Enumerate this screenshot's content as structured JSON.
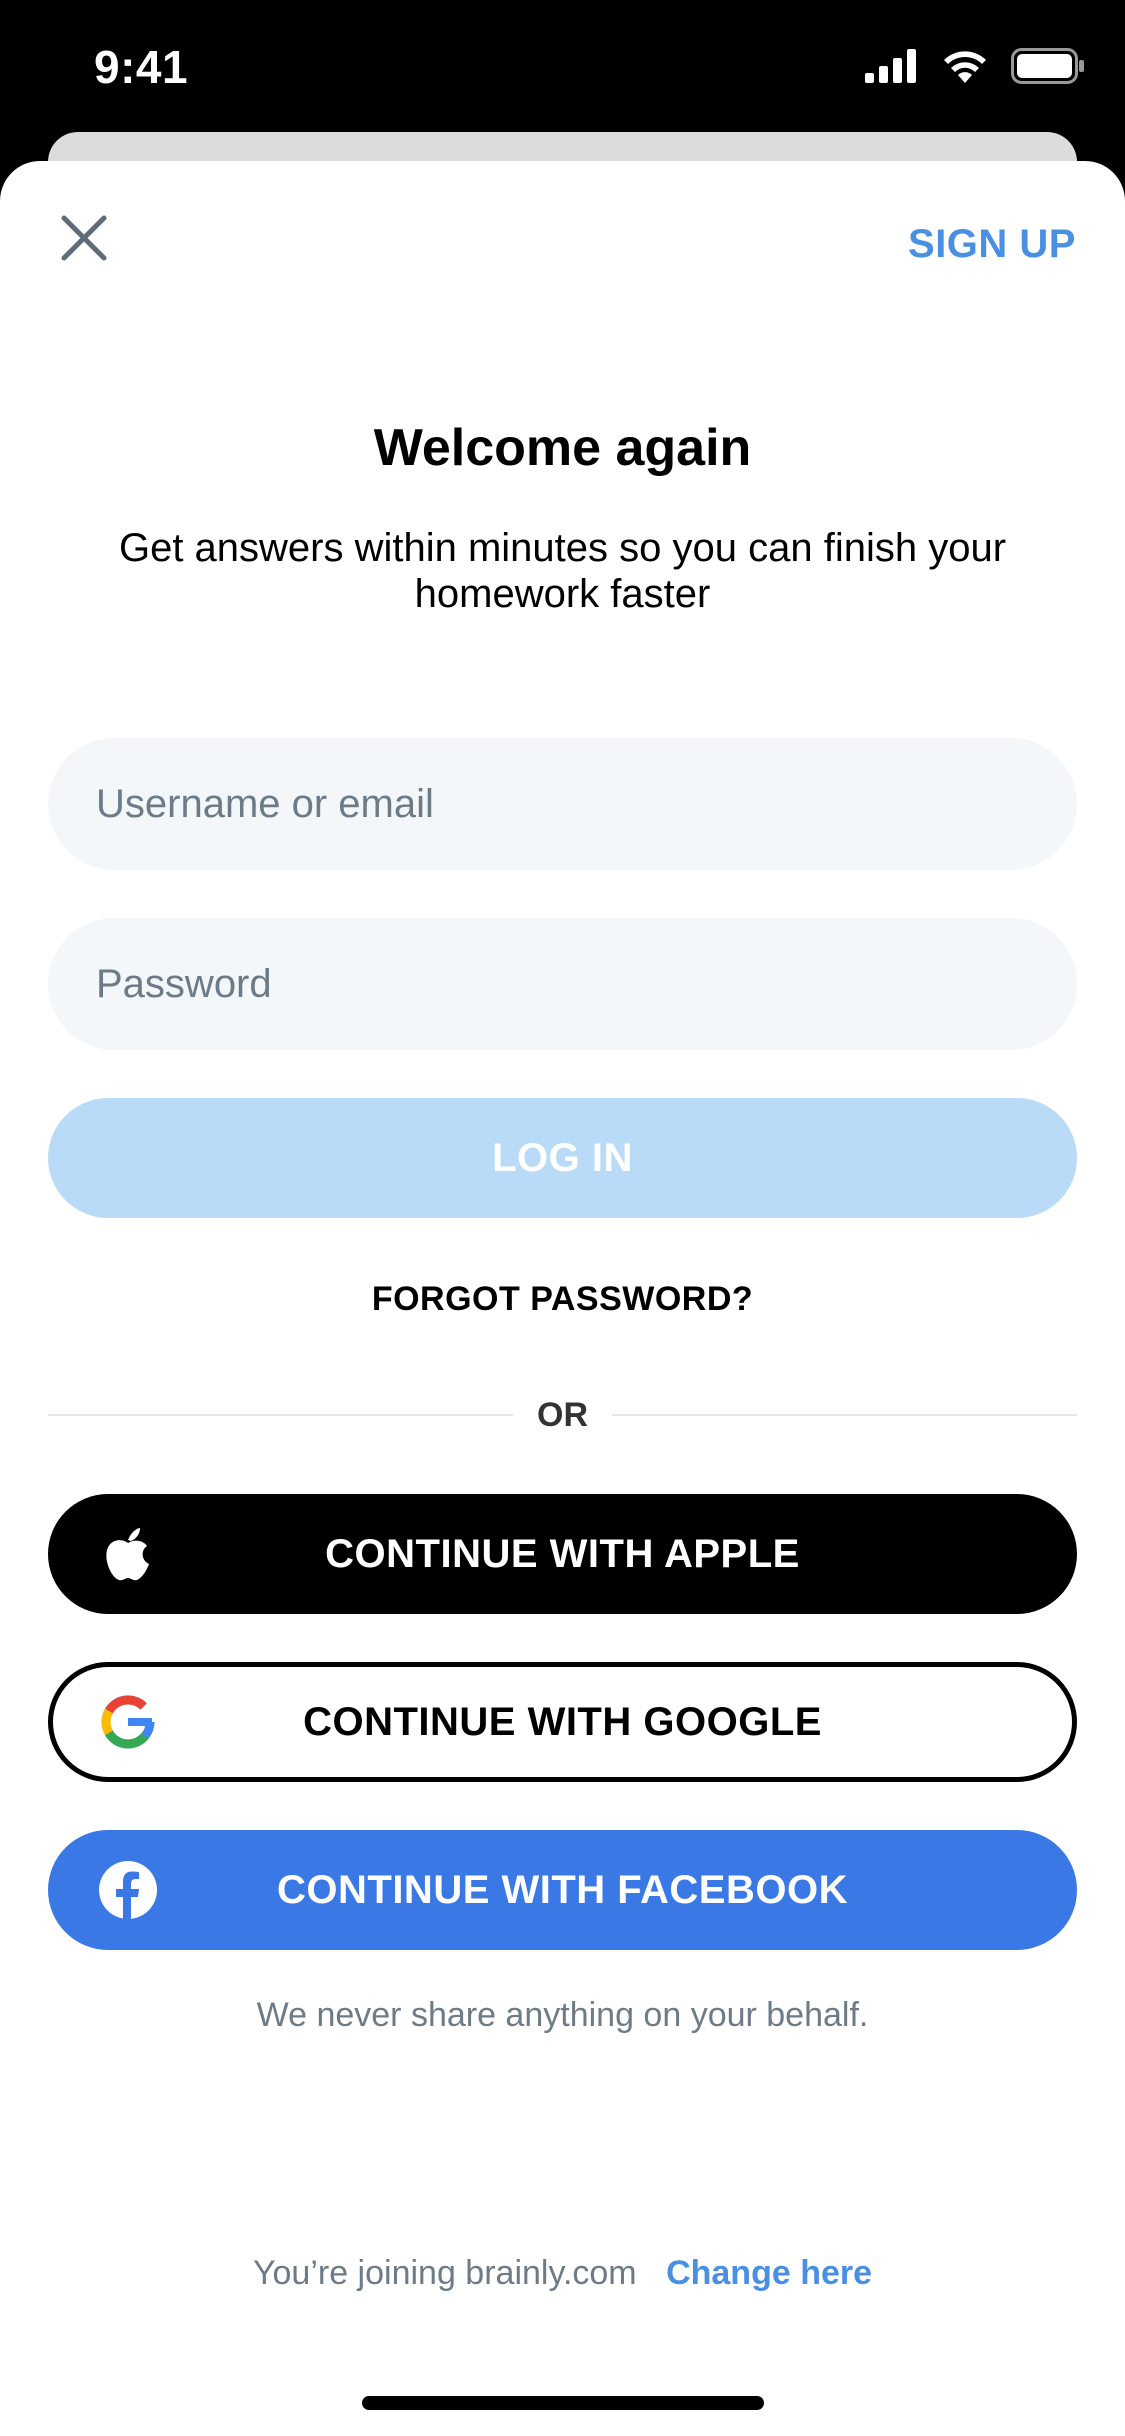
{
  "status_bar": {
    "time": "9:41",
    "icons": [
      "cellular-signal-icon",
      "wifi-icon",
      "battery-icon"
    ]
  },
  "header": {
    "close_icon": "close-icon",
    "signup_label": "SIGN UP"
  },
  "main": {
    "title": "Welcome again",
    "subtitle": "Get answers within minutes so you can finish your homework faster",
    "username": {
      "value": "",
      "placeholder": "Username or email"
    },
    "password": {
      "value": "",
      "placeholder": "Password"
    },
    "login_label": "LOG IN",
    "forgot_label": "FORGOT PASSWORD?",
    "or_label": "OR"
  },
  "social": {
    "apple": {
      "label": "CONTINUE WITH APPLE",
      "icon": "apple-icon"
    },
    "google": {
      "label": "CONTINUE WITH GOOGLE",
      "icon": "google-icon"
    },
    "facebook": {
      "label": "CONTINUE WITH FACEBOOK",
      "icon": "facebook-icon"
    },
    "disclaimer": "We never share anything on your behalf."
  },
  "footer": {
    "joining_text": "You’re joining brainly.com",
    "change_label": "Change here"
  },
  "colors": {
    "accent": "#4a90e2",
    "login_disabled": "#b9dbf7",
    "facebook": "#3a78e6",
    "input_bg": "#f3f7fa",
    "muted_text": "#6d7b88"
  }
}
